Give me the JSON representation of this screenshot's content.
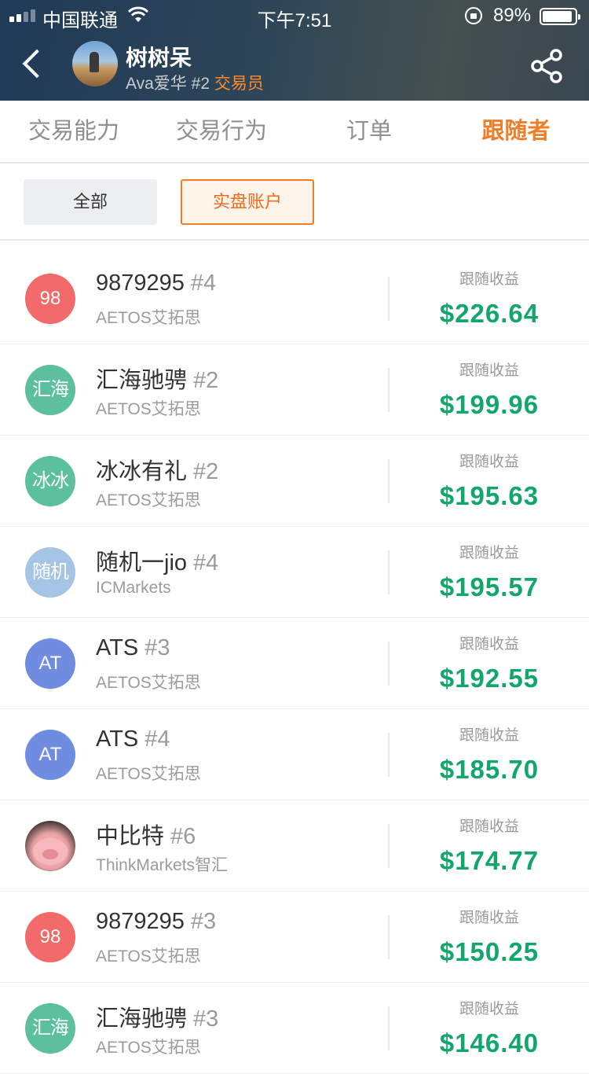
{
  "status_bar": {
    "carrier": "中国联通",
    "time": "下午7:51",
    "battery_pct": "89%"
  },
  "header": {
    "trader_name": "树树呆",
    "broker": "Ava爱华",
    "rank": "#2",
    "role": "交易员"
  },
  "tabs": [
    {
      "label": "交易能力",
      "active": false
    },
    {
      "label": "交易行为",
      "active": false
    },
    {
      "label": "订单",
      "active": false
    },
    {
      "label": "跟随者",
      "active": true
    }
  ],
  "filters": {
    "all": "全部",
    "live": "实盘账户",
    "selected": "live"
  },
  "followers": [
    {
      "avatar_text": "98",
      "avatar_color": "#f36a6a",
      "name": "9879295",
      "rank": "#4",
      "broker": "AETOS艾拓思",
      "profit_label": "跟随收益",
      "profit": "$226.64"
    },
    {
      "avatar_text": "汇海",
      "avatar_color": "#5cbf9d",
      "name": "汇海驰骋",
      "rank": "#2",
      "broker": "AETOS艾拓思",
      "profit_label": "跟随收益",
      "profit": "$199.96"
    },
    {
      "avatar_text": "冰冰",
      "avatar_color": "#5cbf9d",
      "name": "冰冰有礼",
      "rank": "#2",
      "broker": "AETOS艾拓思",
      "profit_label": "跟随收益",
      "profit": "$195.63"
    },
    {
      "avatar_text": "随机",
      "avatar_color": "#a6c5e6",
      "name": "随机一jio",
      "rank": "#4",
      "broker": "ICMarkets",
      "profit_label": "跟随收益",
      "profit": "$195.57"
    },
    {
      "avatar_text": "AT",
      "avatar_color": "#6f8ce0",
      "name": "ATS",
      "rank": "#3",
      "broker": "AETOS艾拓思",
      "profit_label": "跟随收益",
      "profit": "$192.55"
    },
    {
      "avatar_text": "AT",
      "avatar_color": "#6f8ce0",
      "name": "ATS",
      "rank": "#4",
      "broker": "AETOS艾拓思",
      "profit_label": "跟随收益",
      "profit": "$185.70"
    },
    {
      "avatar_text": "",
      "avatar_icon": "pig-avatar",
      "avatar_color": "#eaa2a8",
      "name": "中比特",
      "rank": "#6",
      "broker": "ThinkMarkets智汇",
      "profit_label": "跟随收益",
      "profit": "$174.77"
    },
    {
      "avatar_text": "98",
      "avatar_color": "#f36a6a",
      "name": "9879295",
      "rank": "#3",
      "broker": "AETOS艾拓思",
      "profit_label": "跟随收益",
      "profit": "$150.25"
    },
    {
      "avatar_text": "汇海",
      "avatar_color": "#5cbf9d",
      "name": "汇海驰骋",
      "rank": "#3",
      "broker": "AETOS艾拓思",
      "profit_label": "跟随收益",
      "profit": "$146.40"
    }
  ]
}
